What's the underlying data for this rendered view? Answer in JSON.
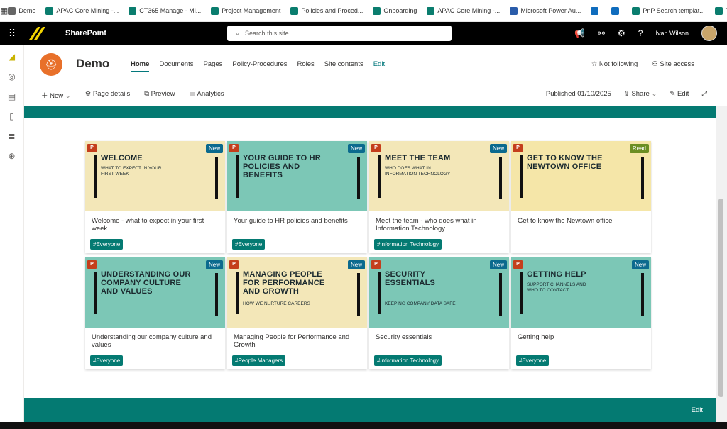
{
  "bookmarks": [
    {
      "label": "Demo",
      "color": "#666666"
    },
    {
      "label": "APAC Core Mining -...",
      "color": "#0a7d6e"
    },
    {
      "label": "CT365 Manage - Mi...",
      "color": "#0a7d6e"
    },
    {
      "label": "Project Management",
      "color": "#0a7d6e"
    },
    {
      "label": "Policies and Proced...",
      "color": "#0a7d6e"
    },
    {
      "label": "Onboarding",
      "color": "#0a7d6e"
    },
    {
      "label": "APAC Core Mining -...",
      "color": "#0a7d6e"
    },
    {
      "label": "Microsoft Power Au...",
      "color": "#2a5caa"
    },
    {
      "label": "",
      "color": "#0f6cbd"
    },
    {
      "label": "",
      "color": "#0f6cbd"
    },
    {
      "label": "PnP Search templat...",
      "color": "#0a7d6e"
    },
    {
      "label": "Test",
      "color": "#0a7d6e"
    }
  ],
  "topbar": {
    "app_name": "SharePoint",
    "search_placeholder": "Search this site",
    "user_name": "Ivan Wilson"
  },
  "site": {
    "name": "Demo",
    "nav": [
      "Home",
      "Documents",
      "Pages",
      "Policy-Procedures",
      "Roles",
      "Site contents"
    ],
    "nav_edit": "Edit",
    "not_following": "Not following",
    "site_access": "Site access"
  },
  "cmdbar": {
    "new": "New",
    "page_details": "Page details",
    "preview": "Preview",
    "analytics": "Analytics",
    "published": "Published 01/10/2025",
    "share": "Share",
    "edit": "Edit"
  },
  "cards": [
    {
      "thumb_title": "WELCOME",
      "thumb_sub": "WHAT TO EXPECT IN YOUR FIRST WEEK",
      "badge": "New",
      "bg": "#f3e7b8",
      "title": "Welcome - what to expect in your first week",
      "tag": "#Everyone"
    },
    {
      "thumb_title": "YOUR GUIDE TO HR POLICIES AND BENEFITS",
      "thumb_sub": "",
      "badge": "New",
      "bg": "#7cc7b6",
      "title": "Your guide to HR policies and benefits",
      "tag": "#Everyone"
    },
    {
      "thumb_title": "MEET THE TEAM",
      "thumb_sub": "WHO DOES WHAT IN INFORMATION TECHNOLOGY",
      "badge": "New",
      "bg": "#f3e7b8",
      "title": "Meet the team - who does what in Information Technology",
      "tag": "#Information Technology"
    },
    {
      "thumb_title": "GET TO KNOW THE NEWTOWN OFFICE",
      "thumb_sub": "",
      "badge": "Read",
      "bg": "#f5e6a8",
      "title": "Get to know the Newtown office",
      "tag": ""
    },
    {
      "thumb_title": "UNDERSTANDING OUR COMPANY CULTURE AND VALUES",
      "thumb_sub": "",
      "badge": "New",
      "bg": "#7cc7b6",
      "title": "Understanding our company culture and values",
      "tag": "#Everyone"
    },
    {
      "thumb_title": "MANAGING PEOPLE FOR PERFORMANCE AND GROWTH",
      "thumb_sub": "HOW WE NURTURE CAREERS",
      "badge": "New",
      "bg": "#f3e7b8",
      "title": "Managing People for Performance and Growth",
      "tag": "#People Managers"
    },
    {
      "thumb_title": "SECURITY ESSENTIALS",
      "thumb_sub": "KEEPING COMPANY DATA SAFE",
      "badge": "New",
      "bg": "#7cc7b6",
      "title": "Security essentials",
      "tag": "#Information Technology"
    },
    {
      "thumb_title": "GETTING HELP",
      "thumb_sub": "SUPPORT CHANNELS AND WHO TO CONTACT",
      "badge": "New",
      "bg": "#7cc7b6",
      "title": "Getting help",
      "tag": "#Everyone"
    }
  ],
  "footer": {
    "edit": "Edit"
  },
  "colors": {
    "accent": "#047a72",
    "badge_new": "#0b6a8e",
    "badge_read": "#6b8e23",
    "ppt": "#c43e1c"
  }
}
